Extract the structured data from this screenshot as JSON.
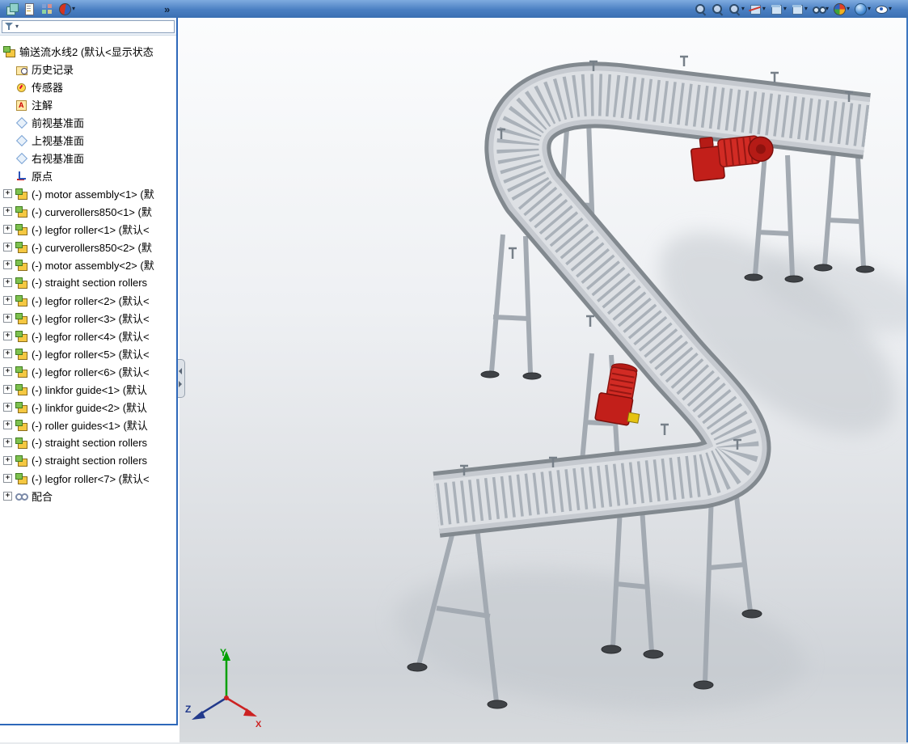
{
  "app": {
    "name": "SolidWorks assembly window",
    "colors": {
      "toolbar_blue": "#3a6fb2",
      "panel_border_blue": "#2e68ba",
      "motor_red": "#c8201c",
      "axis_x_red": "#cc2222",
      "axis_y_green": "#00a000",
      "axis_z_blue": "#223a8c"
    }
  },
  "toolbar": {
    "overflow_chevron": "»",
    "dropdown_glyph": "▾",
    "left_icons": [
      {
        "name": "file-new-icon",
        "glyph": "gi-layers",
        "dropdown": false
      },
      {
        "name": "file-open-icon",
        "glyph": "gi-page",
        "dropdown": false
      },
      {
        "name": "window-layout-icon",
        "glyph": "gi-grid",
        "dropdown": false
      },
      {
        "name": "solidworks-resources-icon",
        "glyph": "gi-sphere",
        "dropdown": true
      }
    ],
    "right_icons": [
      {
        "name": "zoom-fit-icon",
        "glyph": "gi-mag",
        "dropdown": false
      },
      {
        "name": "zoom-area-icon",
        "glyph": "gi-mag",
        "dropdown": false
      },
      {
        "name": "previous-view-icon",
        "glyph": "gi-mag",
        "dropdown": true
      },
      {
        "name": "section-view-icon",
        "glyph": "gi-cubecut",
        "dropdown": true
      },
      {
        "name": "view-orientation-icon",
        "glyph": "gi-cube",
        "dropdown": true
      },
      {
        "name": "display-style-icon",
        "glyph": "gi-cube",
        "dropdown": true
      },
      {
        "name": "hide-show-items-icon",
        "glyph": "gi-glasses",
        "dropdown": true
      },
      {
        "name": "edit-appearance-icon",
        "glyph": "gi-ball",
        "dropdown": true
      },
      {
        "name": "apply-scene-icon",
        "glyph": "gi-globe",
        "dropdown": true
      },
      {
        "name": "view-settings-icon",
        "glyph": "gi-eye",
        "dropdown": true
      }
    ]
  },
  "tree": {
    "expander_glyph": "+",
    "root_label": "输送流水线2 (默认<显示状态",
    "items": [
      {
        "label": "历史记录",
        "icon": "history",
        "expand": false
      },
      {
        "label": "传感器",
        "icon": "sensors",
        "expand": false
      },
      {
        "label": "注解",
        "icon": "annotations",
        "expand": false
      },
      {
        "label": "前视基准面",
        "icon": "plane",
        "expand": false
      },
      {
        "label": "上视基准面",
        "icon": "plane",
        "expand": false
      },
      {
        "label": "右视基准面",
        "icon": "plane",
        "expand": false
      },
      {
        "label": "原点",
        "icon": "origin",
        "expand": false
      },
      {
        "label": "(-) motor assembly<1> (默",
        "icon": "component",
        "expand": true
      },
      {
        "label": "(-) curverollers850<1> (默",
        "icon": "component",
        "expand": true
      },
      {
        "label": "(-) legfor roller<1> (默认<",
        "icon": "component",
        "expand": true
      },
      {
        "label": "(-) curverollers850<2> (默",
        "icon": "component",
        "expand": true
      },
      {
        "label": "(-) motor assembly<2> (默",
        "icon": "component",
        "expand": true
      },
      {
        "label": "(-) straight section rollers",
        "icon": "component",
        "expand": true
      },
      {
        "label": "(-) legfor roller<2> (默认<",
        "icon": "component",
        "expand": true
      },
      {
        "label": "(-) legfor roller<3> (默认<",
        "icon": "component",
        "expand": true
      },
      {
        "label": "(-) legfor roller<4> (默认<",
        "icon": "component",
        "expand": true
      },
      {
        "label": "(-) legfor roller<5> (默认<",
        "icon": "component",
        "expand": true
      },
      {
        "label": "(-) legfor roller<6> (默认<",
        "icon": "component",
        "expand": true
      },
      {
        "label": "(-) linkfor guide<1> (默认",
        "icon": "component",
        "expand": true
      },
      {
        "label": "(-) linkfor guide<2> (默认",
        "icon": "component",
        "expand": true
      },
      {
        "label": "(-) roller guides<1> (默认",
        "icon": "component",
        "expand": true
      },
      {
        "label": "(-) straight section rollers",
        "icon": "component",
        "expand": true
      },
      {
        "label": "(-) straight section rollers",
        "icon": "component",
        "expand": true
      },
      {
        "label": "(-) legfor roller<7> (默认<",
        "icon": "component",
        "expand": true
      },
      {
        "label": "配合",
        "icon": "mates",
        "expand": true
      }
    ]
  },
  "triad": {
    "x_label": "X",
    "y_label": "Y",
    "z_label": "Z"
  }
}
